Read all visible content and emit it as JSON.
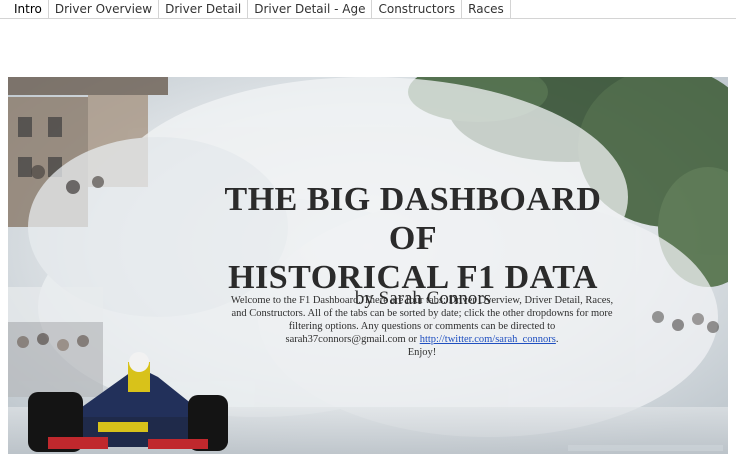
{
  "tabs": [
    {
      "label": "Intro",
      "active": true
    },
    {
      "label": "Driver Overview",
      "active": false
    },
    {
      "label": "Driver Detail",
      "active": false
    },
    {
      "label": "Driver Detail - Age",
      "active": false
    },
    {
      "label": "Constructors",
      "active": false
    },
    {
      "label": "Races",
      "active": false
    }
  ],
  "hero": {
    "title_line1": "THE BIG DASHBOARD",
    "title_line2": "OF",
    "title_line3": "HISTORICAL F1 DATA",
    "byline": "by Sarah Connors",
    "blurb_text": "Welcome to the F1 Dashboard. There are four tabs: Driver Overview, Driver Detail, Races, and Constructors. All of the tabs can be sorted by date; click the other dropdowns for more filtering options. Any questions or comments can be directed to sarah37connors@gmail.com or",
    "link_text": "http://twitter.com/sarah_connors",
    "after_link": ".",
    "enjoy": "Enjoy!"
  }
}
